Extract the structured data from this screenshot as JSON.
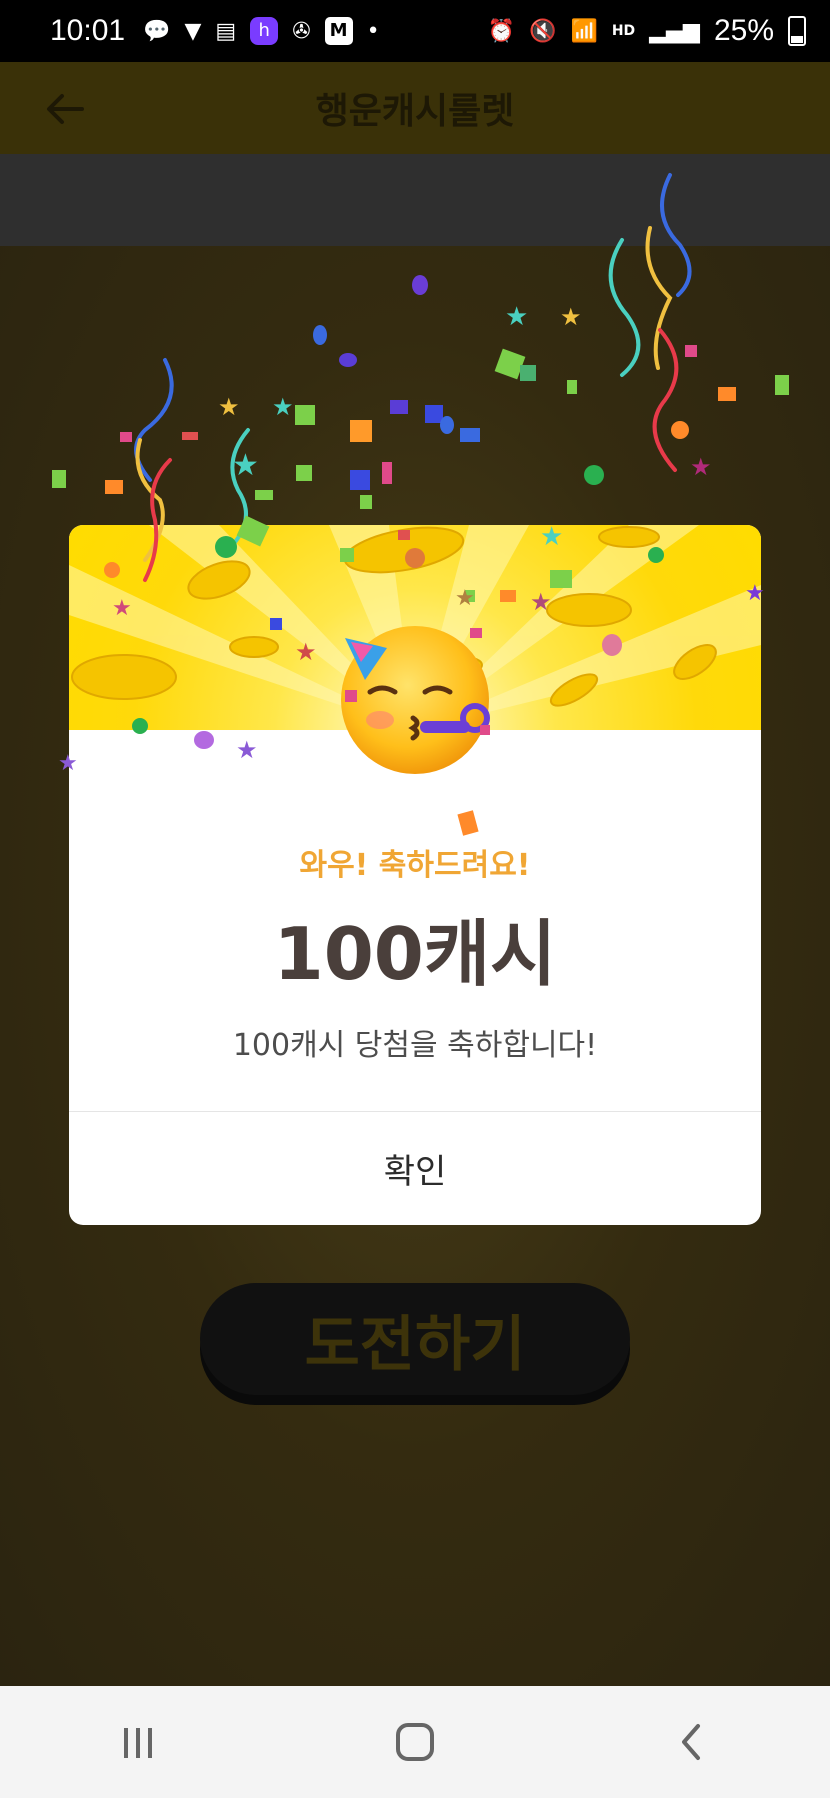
{
  "status_bar": {
    "time": "10:01",
    "battery": "25%",
    "app_badge_h": "h",
    "app_badge_m": "M",
    "hd_label": "HD"
  },
  "header": {
    "title": "행운캐시룰렛"
  },
  "main": {
    "challenge_button": "도전하기"
  },
  "modal": {
    "wow_text": "와우! 축하드려요!",
    "amount_text": "100캐시",
    "description": "100캐시 당첨을 축하합니다!",
    "confirm_label": "확인"
  },
  "colors": {
    "accent_yellow": "#ffdc00",
    "wow_orange": "#f0a634",
    "amount_brown": "#4a3f3b"
  },
  "icons": [
    "back-arrow-icon",
    "party-face-icon",
    "recent-apps-icon",
    "home-icon",
    "nav-back-icon"
  ]
}
